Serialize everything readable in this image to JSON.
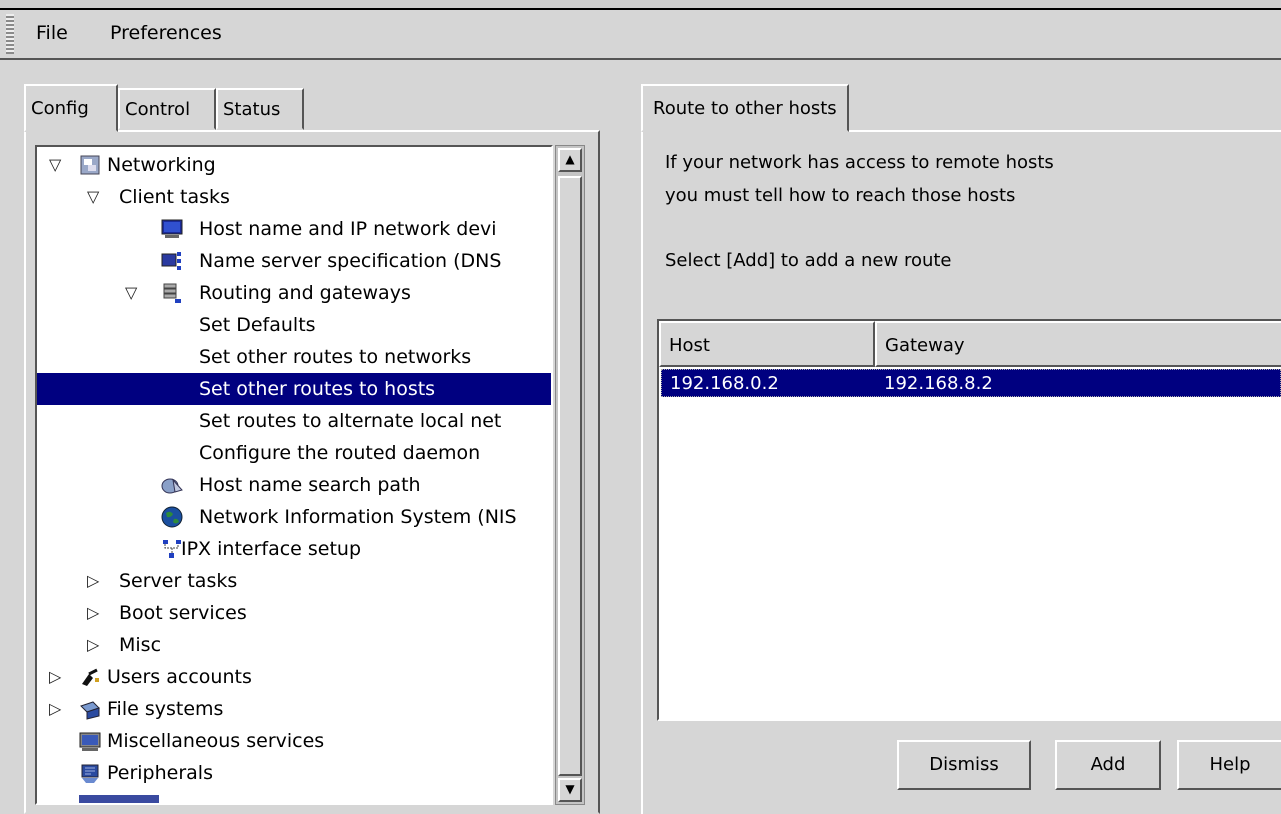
{
  "menu": {
    "file": "File",
    "preferences": "Preferences"
  },
  "left_tabs": [
    "Config",
    "Control",
    "Status"
  ],
  "tree": [
    {
      "label": "Networking",
      "expander": "▽",
      "icon": "networking-icon"
    },
    {
      "label": "Client tasks",
      "expander": "▽"
    },
    {
      "label": "Host name and IP network devi",
      "icon": "monitor-icon"
    },
    {
      "label": "Name server specification (DNS",
      "icon": "dns-icon"
    },
    {
      "label": "Routing and gateways",
      "expander": "▽",
      "icon": "routing-icon"
    },
    {
      "label": "Set Defaults"
    },
    {
      "label": "Set other routes to networks"
    },
    {
      "label": "Set other routes to hosts",
      "selected": true
    },
    {
      "label": "Set routes to alternate local net"
    },
    {
      "label": "Configure the routed daemon"
    },
    {
      "label": "Host name search path",
      "icon": "search-path-icon"
    },
    {
      "label": "Network Information System (NIS",
      "icon": "globe-icon"
    },
    {
      "label": "IPX interface setup",
      "icon": "ipx-icon"
    },
    {
      "label": "Server tasks",
      "expander": "▷"
    },
    {
      "label": "Boot services",
      "expander": "▷"
    },
    {
      "label": "Misc",
      "expander": "▷"
    },
    {
      "label": "Users accounts",
      "expander": "▷",
      "icon": "users-icon"
    },
    {
      "label": "File systems",
      "expander": "▷",
      "icon": "filesystems-icon"
    },
    {
      "label": "Miscellaneous services",
      "icon": "misc-services-icon"
    },
    {
      "label": "Peripherals",
      "icon": "peripherals-icon"
    }
  ],
  "right_tab": "Route to other hosts",
  "info": {
    "line1": "If your network has access to remote hosts",
    "line2": "you must tell how to reach those hosts",
    "line3": "Select [Add] to add a new route"
  },
  "table": {
    "headers": [
      "Host",
      "Gateway"
    ],
    "rows": [
      {
        "host": "192.168.0.2",
        "gateway": "192.168.8.2"
      }
    ]
  },
  "buttons": {
    "dismiss": "Dismiss",
    "add": "Add",
    "help": "Help"
  },
  "colors": {
    "selection": "#000080",
    "window_bg": "#d6d6d6"
  }
}
